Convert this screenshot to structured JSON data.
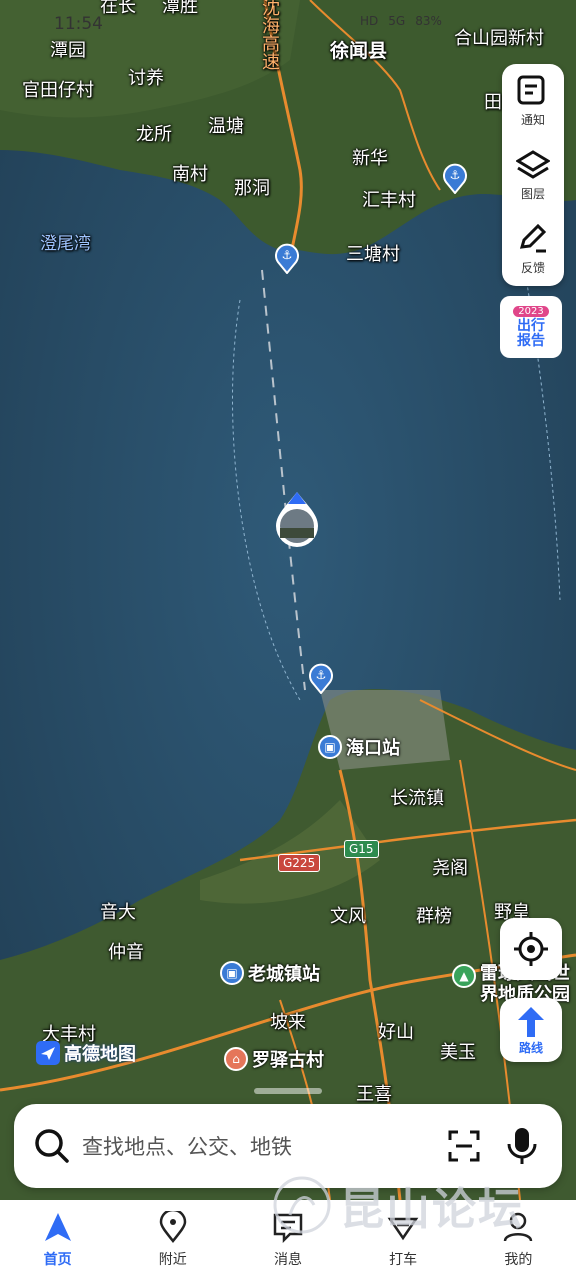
{
  "status_bar": {
    "time": "11:54",
    "network": "HD",
    "signal": "5G",
    "battery": "83%"
  },
  "map": {
    "places": [
      {
        "id": "zaichang",
        "name": "在长"
      },
      {
        "id": "tansheng",
        "name": "潭胜"
      },
      {
        "id": "tanyuan",
        "name": "潭园"
      },
      {
        "id": "guantianzai",
        "name": "官田仔村"
      },
      {
        "id": "taoyang",
        "name": "讨养"
      },
      {
        "id": "longsuo",
        "name": "龙所"
      },
      {
        "id": "wentang",
        "name": "温塘"
      },
      {
        "id": "nancun",
        "name": "南村"
      },
      {
        "id": "nadong",
        "name": "那洞"
      },
      {
        "id": "xuwen",
        "name": "徐闻县"
      },
      {
        "id": "xinhua",
        "name": "新华"
      },
      {
        "id": "huifeng",
        "name": "汇丰村"
      },
      {
        "id": "santang",
        "name": "三塘村"
      },
      {
        "id": "heshanyuan",
        "name": "合山园新村"
      },
      {
        "id": "tian",
        "name": "田"
      },
      {
        "id": "changliu",
        "name": "长流镇"
      },
      {
        "id": "yaoge",
        "name": "尧阁"
      },
      {
        "id": "yinda",
        "name": "音大"
      },
      {
        "id": "wenfeng",
        "name": "文风"
      },
      {
        "id": "qunbang",
        "name": "群榜"
      },
      {
        "id": "yehuang",
        "name": "野皇"
      },
      {
        "id": "zhongyin",
        "name": "仲音"
      },
      {
        "id": "dafeng",
        "name": "大丰村"
      },
      {
        "id": "polai",
        "name": "坡来"
      },
      {
        "id": "haoshan",
        "name": "好山"
      },
      {
        "id": "meiyu",
        "name": "美玉"
      },
      {
        "id": "wangxi",
        "name": "王喜"
      }
    ],
    "bay": "澄尾湾",
    "expressway": "沈海高速",
    "stations": {
      "haikou": "海口站",
      "laocheng": "老城镇站",
      "luoyi": "罗驿古村",
      "geopark": "雷琼火山世界地质公园"
    },
    "road_badges": {
      "g225": "G225",
      "g15": "G15"
    }
  },
  "right_panel": {
    "notify": "通知",
    "layers": "图层",
    "feedback": "反馈"
  },
  "report_badge": {
    "year": "2023",
    "text": "出行报告"
  },
  "route_button": "路线",
  "logo_text": "高德地图",
  "search": {
    "placeholder": "查找地点、公交、地铁"
  },
  "tabs": [
    {
      "label": "首页",
      "icon": "navigation-arrow-icon"
    },
    {
      "label": "附近",
      "icon": "location-pin-icon"
    },
    {
      "label": "消息",
      "icon": "message-icon"
    },
    {
      "label": "打车",
      "icon": "taxi-icon"
    },
    {
      "label": "我的",
      "icon": "user-icon"
    }
  ],
  "watermark": "昆山论坛",
  "colors": {
    "accent": "#2f6cf5",
    "sea": "#2a4b63",
    "land": "#3f5a30",
    "road": "#e88b2e"
  }
}
